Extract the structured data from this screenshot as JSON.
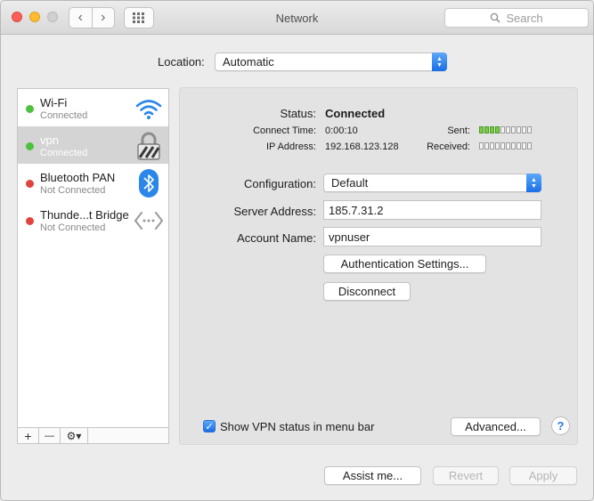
{
  "window": {
    "title": "Network",
    "search_placeholder": "Search",
    "back_glyph": "‹",
    "forward_glyph": "›"
  },
  "location": {
    "label": "Location:",
    "value": "Automatic"
  },
  "sidebar": {
    "items": [
      {
        "name": "Wi-Fi",
        "status": "Connected",
        "status_color": "#4cc13f",
        "icon": "wifi-icon"
      },
      {
        "name": "vpn",
        "status": "Connected",
        "status_color": "#4cc13f",
        "icon": "lock-icon",
        "selected": true
      },
      {
        "name": "Bluetooth PAN",
        "status": "Not Connected",
        "status_color": "#e0443e",
        "icon": "bluetooth-icon"
      },
      {
        "name": "Thunde...t Bridge",
        "status": "Not Connected",
        "status_color": "#e0443e",
        "icon": "thunderbolt-bridge-icon"
      }
    ],
    "add_glyph": "+",
    "remove_glyph": "—",
    "gear_glyph": "⚙▾"
  },
  "detail": {
    "status_label": "Status:",
    "status_value": "Connected",
    "connect_time_label": "Connect Time:",
    "connect_time_value": "0:00:10",
    "ip_label": "IP Address:",
    "ip_value": "192.168.123.128",
    "sent_label": "Sent:",
    "received_label": "Received:",
    "sent_level": 0.4,
    "received_level": 0.0,
    "configuration_label": "Configuration:",
    "configuration_value": "Default",
    "server_label": "Server Address:",
    "server_value": "185.7.31.2",
    "account_label": "Account Name:",
    "account_value": "vpnuser",
    "auth_button": "Authentication Settings...",
    "disconnect_button": "Disconnect",
    "show_status_label": "Show VPN status in menu bar",
    "show_status_checked": true,
    "advanced_button": "Advanced...",
    "help_glyph": "?"
  },
  "footer": {
    "assist_button": "Assist me...",
    "revert_button": "Revert",
    "apply_button": "Apply"
  },
  "colors": {
    "accent": "#1a6fe6",
    "connected": "#4cc13f",
    "disconnected": "#e0443e"
  }
}
